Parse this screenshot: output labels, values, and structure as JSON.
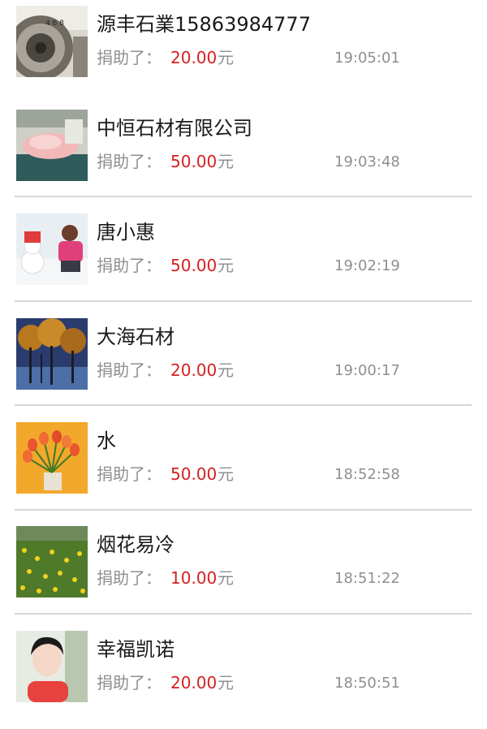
{
  "donations": [
    {
      "name": "源丰石業15863984777",
      "label": "捐助了：",
      "amount": "20.00",
      "unit": "元",
      "time": "19:05:01",
      "avatar_icon": "camera-dial-avatar"
    },
    {
      "name": "中恒石材有限公司",
      "label": "捐助了：",
      "amount": "50.00",
      "unit": "元",
      "time": "19:03:48",
      "avatar_icon": "pink-stone-avatar"
    },
    {
      "name": "唐小惠",
      "label": "捐助了：",
      "amount": "50.00",
      "unit": "元",
      "time": "19:02:19",
      "avatar_icon": "snowman-girl-avatar"
    },
    {
      "name": "大海石材",
      "label": "捐助了：",
      "amount": "20.00",
      "unit": "元",
      "time": "19:00:17",
      "avatar_icon": "autumn-trees-avatar"
    },
    {
      "name": "水",
      "label": "捐助了：",
      "amount": "50.00",
      "unit": "元",
      "time": "18:52:58",
      "avatar_icon": "tulips-avatar"
    },
    {
      "name": "烟花易冷",
      "label": "捐助了：",
      "amount": "10.00",
      "unit": "元",
      "time": "18:51:22",
      "avatar_icon": "yellow-flowers-avatar"
    },
    {
      "name": "幸福凯诺",
      "label": "捐助了：",
      "amount": "20.00",
      "unit": "元",
      "time": "18:50:51",
      "avatar_icon": "woman-portrait-avatar"
    }
  ],
  "colors": {
    "amount": "#d42020",
    "label": "#8f8f8f",
    "name": "#1a1a1a",
    "divider": "#d6d6d6"
  }
}
